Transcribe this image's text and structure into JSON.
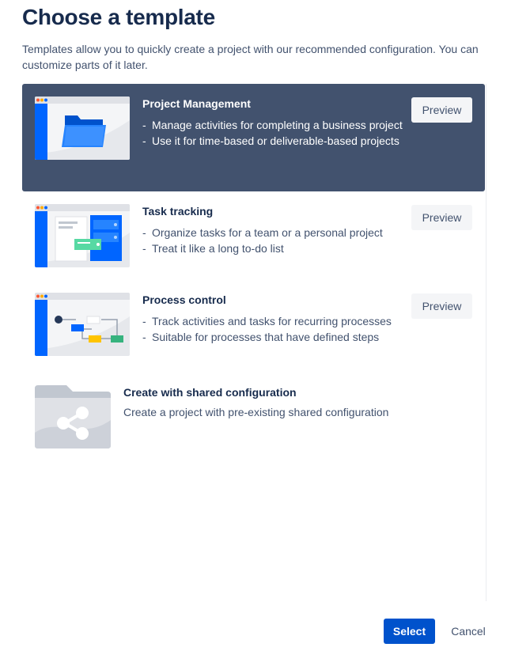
{
  "dialog": {
    "title": "Choose a template",
    "description": "Templates allow you to quickly create a project with our recommended configuration. You can customize parts of it later."
  },
  "templates": [
    {
      "name": "Project Management",
      "selected": true,
      "bullets": [
        "Manage activities for completing a business project",
        "Use it for time-based or deliverable-based projects"
      ],
      "preview_label": "Preview",
      "thumbnail_icon": "folder-icon"
    },
    {
      "name": "Task tracking",
      "selected": false,
      "bullets": [
        "Organize tasks for a team or a personal project",
        "Treat it like a long to-do list"
      ],
      "preview_label": "Preview",
      "thumbnail_icon": "task-board-icon"
    },
    {
      "name": "Process control",
      "selected": false,
      "bullets": [
        "Track activities and tasks for recurring processes",
        "Suitable for processes that have defined steps"
      ],
      "preview_label": "Preview",
      "thumbnail_icon": "workflow-icon"
    }
  ],
  "shared": {
    "name": "Create with shared configuration",
    "description": "Create a project with pre-existing shared configuration",
    "thumbnail_icon": "share-folder-icon"
  },
  "footer": {
    "select_label": "Select",
    "cancel_label": "Cancel"
  },
  "colors": {
    "selected_bg": "#42526e",
    "primary_button": "#0052cc",
    "thumb_blue": "#0065ff"
  }
}
